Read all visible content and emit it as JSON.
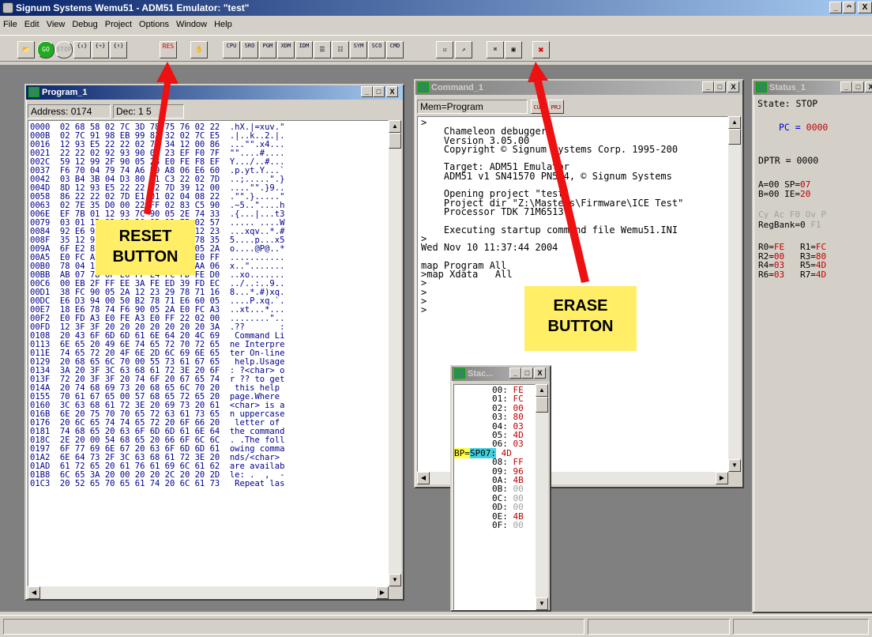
{
  "app": {
    "title": "Signum Systems Wemu51 - ADM51 Emulator: \"test\"",
    "controls": [
      "_",
      "ᴖ",
      "X"
    ]
  },
  "menu": [
    "File",
    "Edit",
    "View",
    "Debug",
    "Project",
    "Options",
    "Window",
    "Help"
  ],
  "toolbar": {
    "buttons": [
      {
        "name": "open-project-button",
        "label": "📂"
      },
      {
        "name": "go-button",
        "label": "GO"
      },
      {
        "name": "stop-button",
        "label": "STOP"
      },
      {
        "name": "step-into-button",
        "label": "{↓}"
      },
      {
        "name": "step-over-button",
        "label": "{↷}"
      },
      {
        "name": "step-out-button",
        "label": "{↑}"
      },
      {
        "name": "reset-button",
        "label": "RES"
      },
      {
        "name": "erase-breakpoints-button",
        "label": "✋"
      },
      {
        "name": "cpu-window-button",
        "label": "CPU"
      },
      {
        "name": "sro-window-button",
        "label": "SRO"
      },
      {
        "name": "pgm-window-button",
        "label": "PGM"
      },
      {
        "name": "xdm-window-button",
        "label": "XDM"
      },
      {
        "name": "idm-window-button",
        "label": "IDM"
      },
      {
        "name": "watch-window-button",
        "label": "☰"
      },
      {
        "name": "regs-window-button",
        "label": "☷"
      },
      {
        "name": "sym-window-button",
        "label": "SYM"
      },
      {
        "name": "sco-window-button",
        "label": "SCO"
      },
      {
        "name": "cmd-window-button",
        "label": "CMD"
      },
      {
        "name": "project-button",
        "label": "☑"
      },
      {
        "name": "load-button",
        "label": "↗"
      },
      {
        "name": "find-button",
        "label": "⌘"
      },
      {
        "name": "view-button",
        "label": "▣"
      },
      {
        "name": "erase-button",
        "label": "✖"
      }
    ]
  },
  "program": {
    "title": "Program_1",
    "address": "Address: 0174",
    "dec": "Dec: 1  5",
    "controls": [
      "_",
      "□",
      "X"
    ],
    "rows": [
      "0000  02 68 58 02 7C 3D 78 75 76 02 22  .hX.|=xuv.\"",
      "000B  02 7C 91 98 EB 99 83 32 02 7C E5  .|..k..2.|.",
      "0016  12 93 E5 22 22 02 78 34 12 00 86  ...\"\".x4...",
      "0021  22 22 02 92 93 90 05 23 EF F0 7F  \"\"....#....",
      "002C  59 12 99 2F 90 05 23 E0 FE F8 EF  Y.../..#...",
      "0037  F6 70 04 79 74 A6 59 A8 06 E6 60  .p.yt.Y...`",
      "0042  03 B4 3B 04 D3 80 01 C3 22 02 7D  ..;.....\".}",
      "004D  8D 12 93 E5 22 22 02 7D 39 12 00  ....\"\".}9..",
      "0058  86 22 22 02 7D E1 01 02 04 08 22  .\"\".}.....\"",
      "0063  02 7E 35 D0 00 22 FF 02 83 C5 90  .~5..\"....h",
      "006E  EF 7B 01 12 93 7C 90 05 2E 74 33  .{...|...t3",
      "0079  03 01 12 92 12 20 02 92 E5 02 57  ..... ....W",
      "0084  92 E6 93 78 71 76 90 05 2A 12 23  ...xqv..*.#",
      "008F  35 12 91 EC 02 70 12 91 B8 78 35  5....p...x5",
      "009A  6F E2 8B 86 D1 40 50 40 90 05 2A  o....@P@..*",
      "00A5  E0 FC A3 E0 FD A3 E0 FE A3 E0 FF  ...........",
      "00B0  78 04 12 22 D9 C0 04 A9 05 AA 06  x..\".......",
      "00BB  AB 07 78 6F E6 FF E4 FC FD FE D0  ..xo.......",
      "00C6  00 EB 2F FF EE 3A FE ED 39 FD EC  ../..:..9..",
      "00D1  38 FC 90 05 2A 12 23 29 78 71 16  8...*.#)xq.",
      "00DC  E6 D3 94 00 50 B2 78 71 E6 60 05  ....P.xq.`.",
      "00E7  18 E6 78 74 F6 90 05 2A E0 FC A3  ..xt...*...",
      "00F2  E0 FD A3 E0 FE A3 E0 FF 22 02 00  ........\"..",
      "00FD  12 3F 3F 20 20 20 20 20 20 20 3A  .??       :",
      "0108  20 43 6F 6D 6D 61 6E 64 20 4C 69   Command Li",
      "0113  6E 65 20 49 6E 74 65 72 70 72 65  ne Interpre",
      "011E  74 65 72 20 4F 6E 2D 6C 69 6E 65  ter On-line",
      "0129  20 68 65 6C 70 00 55 73 61 67 65   help.Usage",
      "0134  3A 20 3F 3C 63 68 61 72 3E 20 6F  : ?<char> o",
      "013F  72 20 3F 3F 20 74 6F 20 67 65 74  r ?? to get",
      "014A  20 74 68 69 73 20 68 65 6C 70 20   this help ",
      "0155  70 61 67 65 00 57 68 65 72 65 20  page.Where ",
      "0160  3C 63 68 61 72 3E 20 69 73 20 61  <char> is a",
      "016B  6E 20 75 70 70 65 72 63 61 73 65  n uppercase",
      "0176  20 6C 65 74 74 65 72 20 6F 66 20   letter of ",
      "0181  74 68 65 20 63 6F 6D 6D 61 6E 64  the command",
      "018C  2E 20 00 54 68 65 20 66 6F 6C 6C  . .The foll",
      "0197  6F 77 69 6E 67 20 63 6F 6D 6D 61  owing comma",
      "01A2  6E 64 73 2F 3C 63 68 61 72 3E 20  nds/<char> ",
      "01AD  61 72 65 20 61 76 61 69 6C 61 62  are availab",
      "01B8  6C 65 3A 20 00 20 20 2C 20 20 2D  le: .  ,  -",
      "01C3  20 52 65 70 65 61 74 20 6C 61 73   Repeat las"
    ]
  },
  "command": {
    "title": "Command_1",
    "mem": "Mem=Program",
    "btn1": "CUR",
    "btn2": "PRJ",
    "controls": [
      "_",
      "□",
      "X"
    ],
    "lines": [
      ">",
      "    Chameleon debugger",
      "    Version 3.05.00",
      "    Copyright © Signum Systems Corp. 1995-200",
      "",
      "    Target: ADM51 Emulator",
      "    ADM51 v1 SN41570 PN574, © Signum Systems",
      "",
      "    Opening project \"test\"",
      "    Project dir \"Z:\\Masters\\Firmware\\ICE Test\"",
      "    Processor TDK 71M6513",
      "",
      "    Executing startup command file Wemu51.INI",
      ">",
      "Wed Nov 10 11:37:44 2004",
      "",
      "map Program All",
      ">map Xdata   All",
      ">",
      ">",
      ">",
      ">"
    ]
  },
  "status": {
    "title": "Status_1",
    "controls": [
      "_",
      "□",
      "X"
    ],
    "state_label": "State:",
    "state_value": "STOP",
    "pc_label": "PC =",
    "pc_value": "0000",
    "dptr_label": "DPTR =",
    "dptr_value": "0000",
    "a_label": "A=",
    "a_value": "00",
    "sp_label": "SP=",
    "sp_value": "07",
    "b_label": "B=",
    "b_value": "00",
    "ie_label": "IE=",
    "ie_value": "20",
    "flags": "Cy Ac F0 Ov P",
    "regbank_label": "RegBank=",
    "regbank_value": "0",
    "f1": "F1",
    "regs": [
      {
        "l": "R0=",
        "v": "FE",
        "l2": "R1=",
        "v2": "FC"
      },
      {
        "l": "R2=",
        "v": "00",
        "l2": "R3=",
        "v2": "80"
      },
      {
        "l": "R4=",
        "v": "03",
        "l2": "R5=",
        "v2": "4D"
      },
      {
        "l": "R6=",
        "v": "03",
        "l2": "R7=",
        "v2": "4D"
      }
    ]
  },
  "stack": {
    "title": "Stac...",
    "controls": [
      "_",
      "□",
      "X"
    ],
    "bp_label": "BP=",
    "sp_label": "SP",
    "rows": [
      {
        "addr": "00:",
        "val": "FE",
        "bp": false
      },
      {
        "addr": "01:",
        "val": "FC",
        "bp": false
      },
      {
        "addr": "02:",
        "val": "00",
        "bp": false
      },
      {
        "addr": "03:",
        "val": "80",
        "bp": false
      },
      {
        "addr": "04:",
        "val": "03",
        "bp": false
      },
      {
        "addr": "05:",
        "val": "4D",
        "bp": false
      },
      {
        "addr": "06:",
        "val": "03",
        "bp": false
      },
      {
        "addr": "07:",
        "val": "4D",
        "bp": true
      },
      {
        "addr": "08:",
        "val": "FF",
        "bp": false
      },
      {
        "addr": "09:",
        "val": "96",
        "bp": false
      },
      {
        "addr": "0A:",
        "val": "4B",
        "bp": false
      },
      {
        "addr": "0B:",
        "val": "00",
        "bp": false
      },
      {
        "addr": "0C:",
        "val": "00",
        "bp": false
      },
      {
        "addr": "0D:",
        "val": "00",
        "bp": false
      },
      {
        "addr": "0E:",
        "val": "4B",
        "bp": false
      },
      {
        "addr": "0F:",
        "val": "00",
        "bp": false
      }
    ]
  },
  "callouts": {
    "reset": "RESET\nBUTTON",
    "erase": "ERASE\nBUTTON"
  },
  "colors": {
    "title_active": "#0a246a",
    "title_inactive": "#808080",
    "value_red": "#c00000",
    "value_blue": "#0000cc",
    "callout": "#ffee66",
    "arrow": "#ee1111"
  }
}
